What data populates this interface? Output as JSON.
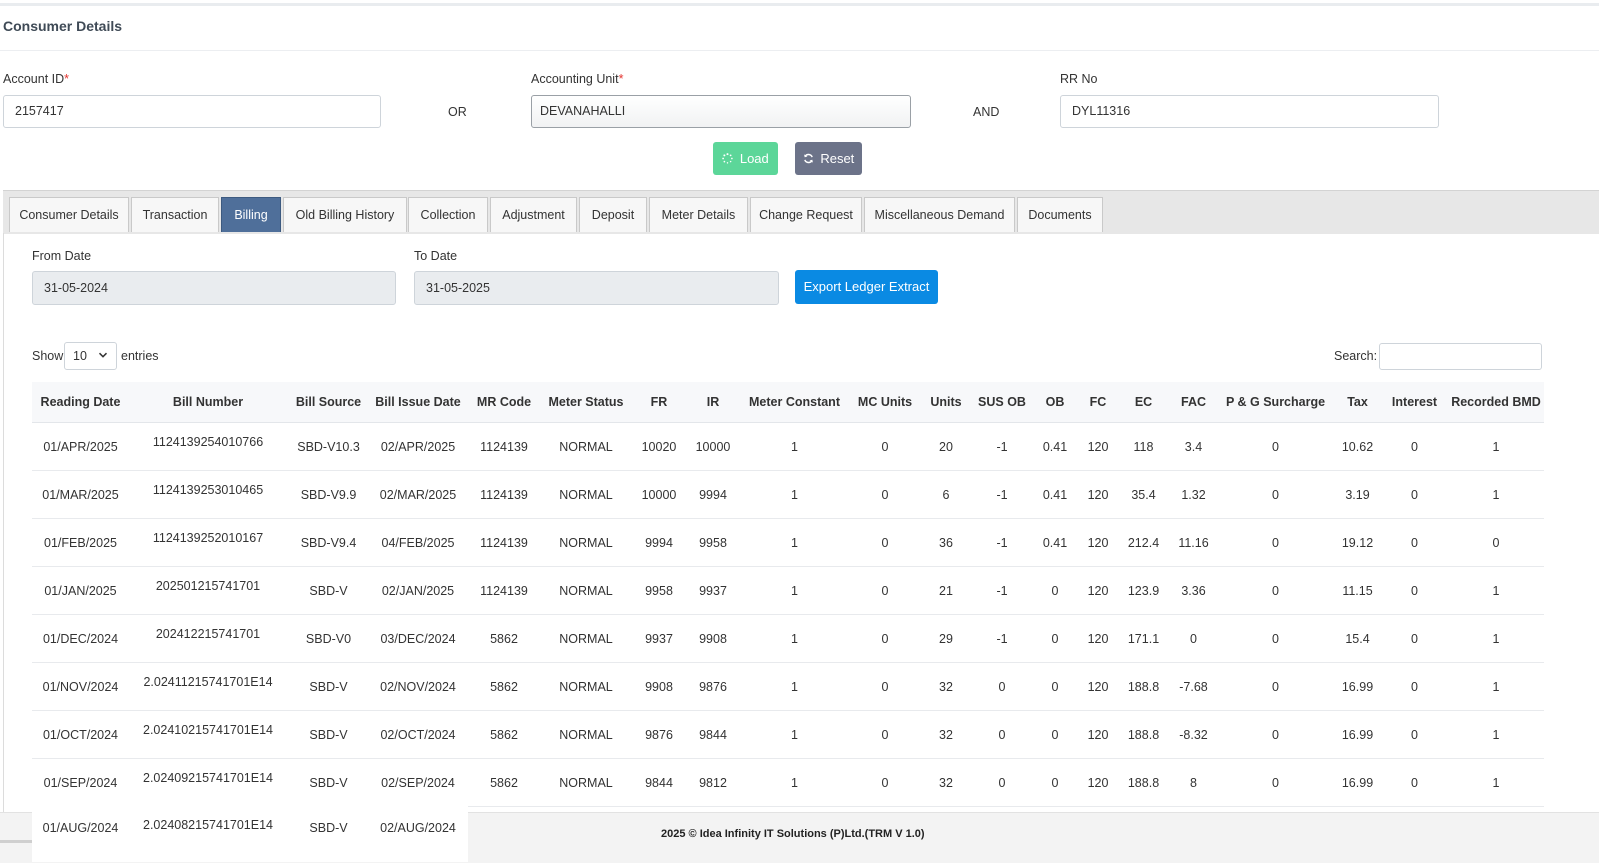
{
  "page": {
    "title": "Consumer Details"
  },
  "form": {
    "account_id_label": "Account ID",
    "account_id_value": "2157417",
    "or_text": "OR",
    "accounting_unit_label": "Accounting Unit",
    "accounting_unit_value": "DEVANAHALLI",
    "and_text": "AND",
    "rr_no_label": "RR No",
    "rr_no_value": "DYL11316",
    "required_mark": "*",
    "load_label": "Load",
    "reset_label": "Reset"
  },
  "tabs": [
    "Consumer Details",
    "Transaction",
    "Billing",
    "Old Billing History",
    "Collection",
    "Adjustment",
    "Deposit",
    "Meter Details",
    "Change Request",
    "Miscellaneous Demand",
    "Documents"
  ],
  "active_tab": "Billing",
  "billing": {
    "from_date_label": "From Date",
    "from_date_value": "31-05-2024",
    "to_date_label": "To Date",
    "to_date_value": "31-05-2025",
    "export_label": "Export Ledger Extract"
  },
  "table_controls": {
    "show_label": "Show",
    "page_length": "10",
    "entries_label": "entries",
    "search_label": "Search:"
  },
  "table": {
    "columns": [
      "Reading Date",
      "Bill Number",
      "Bill Source",
      "Bill Issue Date",
      "MR Code",
      "Meter Status",
      "FR",
      "IR",
      "Meter Constant",
      "MC Units",
      "Units",
      "SUS OB",
      "OB",
      "FC",
      "EC",
      "FAC",
      "P & G Surcharge",
      "Tax",
      "Interest",
      "Recorded BMD"
    ],
    "rows": [
      [
        "01/APR/2025",
        "1124139254010766",
        "SBD-V10.3",
        "02/APR/2025",
        "1124139",
        "NORMAL",
        "10020",
        "10000",
        "1",
        "0",
        "20",
        "-1",
        "0.41",
        "120",
        "118",
        "3.4",
        "0",
        "10.62",
        "0",
        "1"
      ],
      [
        "01/MAR/2025",
        "1124139253010465",
        "SBD-V9.9",
        "02/MAR/2025",
        "1124139",
        "NORMAL",
        "10000",
        "9994",
        "1",
        "0",
        "6",
        "-1",
        "0.41",
        "120",
        "35.4",
        "1.32",
        "0",
        "3.19",
        "0",
        "1"
      ],
      [
        "01/FEB/2025",
        "1124139252010167",
        "SBD-V9.4",
        "04/FEB/2025",
        "1124139",
        "NORMAL",
        "9994",
        "9958",
        "1",
        "0",
        "36",
        "-1",
        "0.41",
        "120",
        "212.4",
        "11.16",
        "0",
        "19.12",
        "0",
        "0"
      ],
      [
        "01/JAN/2025",
        "202501215741701",
        "SBD-V",
        "02/JAN/2025",
        "1124139",
        "NORMAL",
        "9958",
        "9937",
        "1",
        "0",
        "21",
        "-1",
        "0",
        "120",
        "123.9",
        "3.36",
        "0",
        "11.15",
        "0",
        "1"
      ],
      [
        "01/DEC/2024",
        "202412215741701",
        "SBD-V0",
        "03/DEC/2024",
        "5862",
        "NORMAL",
        "9937",
        "9908",
        "1",
        "0",
        "29",
        "-1",
        "0",
        "120",
        "171.1",
        "0",
        "0",
        "15.4",
        "0",
        "1"
      ],
      [
        "01/NOV/2024",
        "2.02411215741701E14",
        "SBD-V",
        "02/NOV/2024",
        "5862",
        "NORMAL",
        "9908",
        "9876",
        "1",
        "0",
        "32",
        "0",
        "0",
        "120",
        "188.8",
        "-7.68",
        "0",
        "16.99",
        "0",
        "1"
      ],
      [
        "01/OCT/2024",
        "2.02410215741701E14",
        "SBD-V",
        "02/OCT/2024",
        "5862",
        "NORMAL",
        "9876",
        "9844",
        "1",
        "0",
        "32",
        "0",
        "0",
        "120",
        "188.8",
        "-8.32",
        "0",
        "16.99",
        "0",
        "1"
      ],
      [
        "01/SEP/2024",
        "2.02409215741701E14",
        "SBD-V",
        "02/SEP/2024",
        "5862",
        "NORMAL",
        "9844",
        "9812",
        "1",
        "0",
        "32",
        "0",
        "0",
        "120",
        "188.8",
        "8",
        "0",
        "16.99",
        "0",
        "1"
      ]
    ],
    "partial_row": [
      "01/AUG/2024",
      "2.02408215741701E14",
      "SBD-V",
      "02/AUG/2024"
    ]
  },
  "footer": {
    "text": "2025 © Idea Infinity IT Solutions (P)Ltd.(TRM V 1.0)"
  },
  "icons": {
    "load": "spinner-icon",
    "reset": "refresh-icon",
    "select": "chevron-down-icon"
  },
  "colors": {
    "load_button": "#5cd699",
    "reset_button": "#6c7389",
    "active_tab": "#4f6f9a",
    "export_button": "#0a8ae3"
  }
}
